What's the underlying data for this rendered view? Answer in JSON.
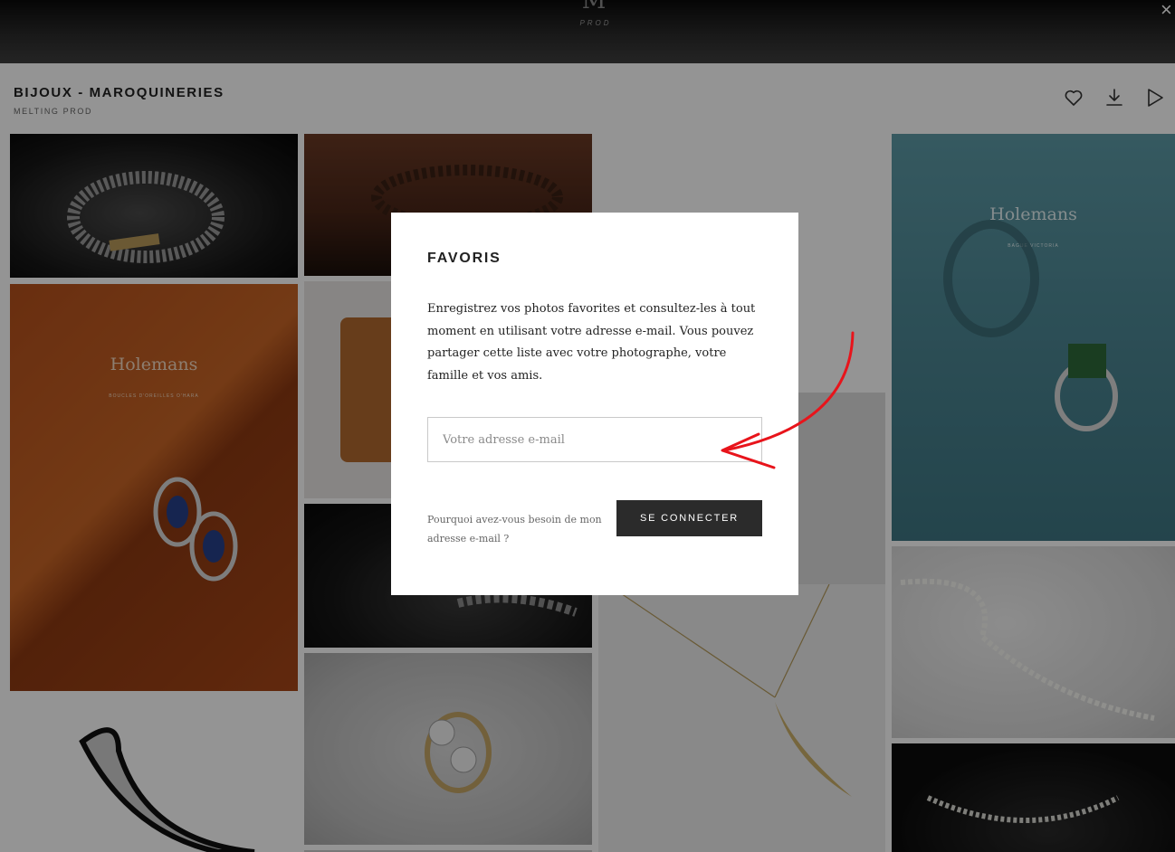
{
  "hero": {
    "logo_mark": "M",
    "logo_text": "PROD",
    "close_symbol": "×"
  },
  "header": {
    "title": "BIJOUX - MAROQUINERIES",
    "subtitle": "MELTING PROD",
    "actions": [
      {
        "icon": "heart-icon"
      },
      {
        "icon": "download-icon"
      },
      {
        "icon": "play-icon"
      }
    ]
  },
  "gallery": {
    "ads": [
      {
        "brand": "Holemans",
        "headline": "BOUCLES D'OREILLES O'HARA"
      },
      {
        "brand": "Holemans",
        "headline": "BAGUE VICTORIA"
      }
    ]
  },
  "modal": {
    "title": "FAVORIS",
    "description": "Enregistrez vos photos favorites et consultez-les à tout moment en utilisant votre adresse e-mail. Vous pouvez partager cette liste avec votre photographe, votre famille et vos amis.",
    "email_placeholder": "Votre adresse e-mail",
    "why_link": "Pourquoi avez-vous besoin de mon adresse e-mail ?",
    "connect_label": "SE CONNECTER"
  },
  "colors": {
    "overlay": "rgba(0,0,0,0.42)",
    "button_bg": "#2b2b2b",
    "annotation_arrow": "#e8141b"
  }
}
